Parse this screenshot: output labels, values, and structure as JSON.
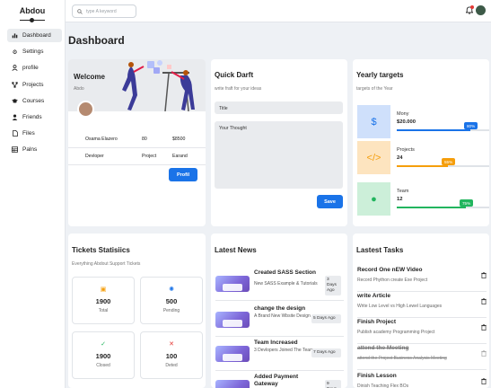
{
  "sidebar": {
    "brand": "Abdou",
    "items": [
      {
        "label": "Dashboard",
        "icon": "chart-icon",
        "active": true
      },
      {
        "label": "Settings",
        "icon": "gear-icon"
      },
      {
        "label": "profile",
        "icon": "user-icon"
      },
      {
        "label": "Projects",
        "icon": "diagram-icon"
      },
      {
        "label": "Courses",
        "icon": "graduation-cap-icon"
      },
      {
        "label": "Friends",
        "icon": "users-icon"
      },
      {
        "label": "Files",
        "icon": "file-icon"
      },
      {
        "label": "Palns",
        "icon": "table-icon"
      }
    ]
  },
  "header": {
    "search_placeholder": "type A keyword"
  },
  "page_title": "Dashboard",
  "welcome": {
    "title": "Welcome",
    "name": "Abdo",
    "stats": [
      [
        "Osama Elazero",
        "80",
        "$8500"
      ],
      [
        "Devloper",
        "Project",
        "Earand"
      ]
    ],
    "button": "Profil"
  },
  "draft": {
    "title": "Quick Darft",
    "subtitle": "write fraft for your ideas",
    "title_value": "Title",
    "thought_value": "Your Thought",
    "button": "Save"
  },
  "targets": {
    "title": "Yearly targets",
    "subtitle": "targets of the Year",
    "items": [
      {
        "label": "Mony",
        "value": "$20.000",
        "percent": "80%",
        "fraction": 0.8,
        "color": "#1a73e8",
        "bg": "#cfe0fb",
        "icon": "dollar-icon",
        "glyph": "$"
      },
      {
        "label": "Projects",
        "value": "24",
        "percent": "55%",
        "fraction": 0.55,
        "color": "#f59e0b",
        "bg": "#fde4bf",
        "icon": "code-icon",
        "glyph": "</>"
      },
      {
        "label": "Team",
        "value": "12",
        "percent": "75%",
        "fraction": 0.75,
        "color": "#22b55e",
        "bg": "#ccefd9",
        "icon": "user-icon",
        "glyph": "●"
      }
    ]
  },
  "tickets": {
    "title": "Tickets Statisiics",
    "subtitle": "Everything Abdout Support Tickets",
    "items": [
      {
        "value": "1900",
        "label": "Total",
        "icon": "calendar-icon",
        "glyph": "▣",
        "color": "#f59e0b"
      },
      {
        "value": "500",
        "label": "Pending",
        "icon": "spinner-icon",
        "glyph": "✺",
        "color": "#1a73e8"
      },
      {
        "value": "1900",
        "label": "Closed",
        "icon": "check-circle-icon",
        "glyph": "✓",
        "color": "#22b55e"
      },
      {
        "value": "100",
        "label": "Deted",
        "icon": "close-icon",
        "glyph": "✕",
        "color": "#e53935"
      }
    ]
  },
  "news": {
    "title": "Latest News",
    "items": [
      {
        "title": "Created SASS Section",
        "desc": "New SASS Example & Tutorials",
        "date": "3 Days Ago"
      },
      {
        "title": "change the design",
        "desc": "A Brand New Wbsite Design",
        "date": "5 Days Ago"
      },
      {
        "title": "Team Increased",
        "desc": "3 Devlopers Joined The Team",
        "date": "7 Days Ago"
      },
      {
        "title": "Added Payment Gateway",
        "desc": "",
        "date": "9 Days Ago"
      }
    ]
  },
  "tasks": {
    "title": "Lastest Tasks",
    "items": [
      {
        "title": "Record One nEW Video",
        "desc": "Record Phython create Exe Project",
        "done": false
      },
      {
        "title": "write Article",
        "desc": "Write Low Level vs High Lewel Languages",
        "done": false
      },
      {
        "title": "Finish Project",
        "desc": "Publish academy Programming Project",
        "done": false
      },
      {
        "title": "attend the Meeting",
        "desc": "attend the Project Business Analysis Meeting",
        "done": true
      },
      {
        "title": "Finish Lesson",
        "desc": "Dinish Teaching Flex BOs",
        "done": false
      }
    ]
  }
}
